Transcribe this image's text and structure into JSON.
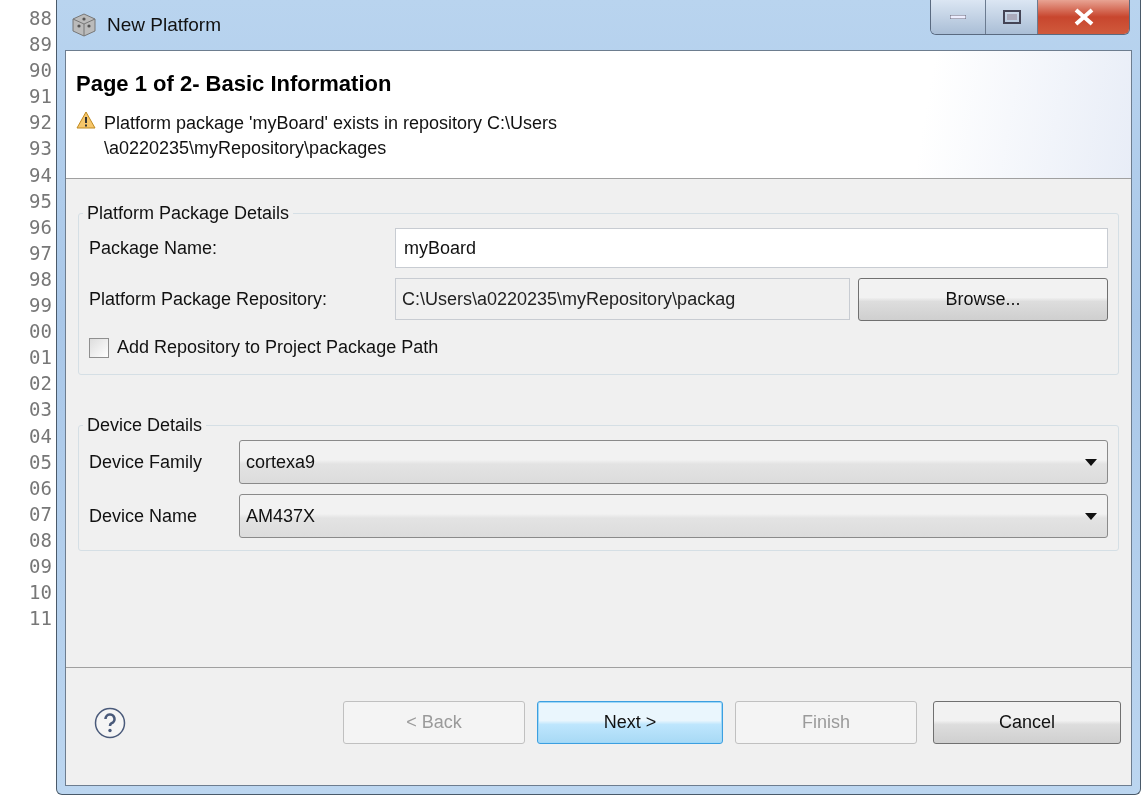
{
  "editor": {
    "line_numbers": [
      "88",
      "89",
      "90",
      "91",
      "92",
      "93",
      "94",
      "95",
      "96",
      "97",
      "98",
      "99",
      "00",
      "01",
      "02",
      "03",
      "04",
      "05",
      "06",
      "07",
      "08",
      "09",
      "10",
      "11"
    ]
  },
  "window": {
    "title": "New Platform"
  },
  "header": {
    "title": "Page 1 of 2- Basic Information",
    "message_lines": [
      "Platform package 'myBoard' exists in repository C:\\Users",
      "\\a0220235\\myRepository\\packages"
    ]
  },
  "groups": [
    {
      "title": "Platform Package Details",
      "rows": [
        {
          "kind": "text",
          "label": "Package Name:",
          "value": "myBoard"
        },
        {
          "kind": "path",
          "label": "Platform Package Repository:",
          "value": "C:\\Users\\a0220235\\myRepository\\packag",
          "button": "Browse..."
        },
        {
          "kind": "checkbox",
          "label": "Add Repository to Project Package Path",
          "checked": false
        }
      ]
    },
    {
      "title": "Device Details",
      "rows": [
        {
          "kind": "combo",
          "label": "Device Family",
          "value": "cortexa9"
        },
        {
          "kind": "combo",
          "label": "Device Name",
          "value": "AM437X"
        }
      ]
    }
  ],
  "buttons": [
    {
      "label": "< Back",
      "disabled": true,
      "default": false
    },
    {
      "label": "Next >",
      "disabled": false,
      "default": true
    },
    {
      "label": "Finish",
      "disabled": true,
      "default": false
    },
    {
      "label": "Cancel",
      "disabled": false,
      "default": false
    }
  ]
}
